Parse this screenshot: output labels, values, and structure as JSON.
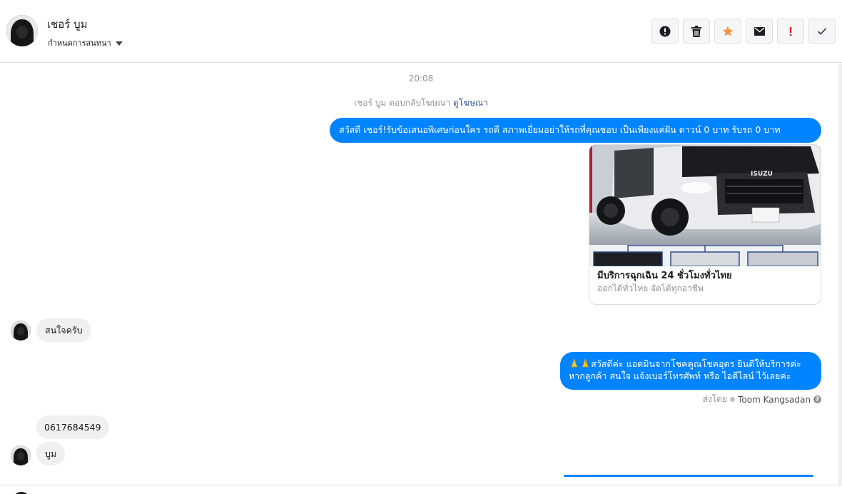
{
  "header": {
    "contact_name": "เชอร์ บูม",
    "assign_label": "กำหนดการสนทนา",
    "actions": [
      {
        "name": "report-spam",
        "icon": "alert-circle-icon"
      },
      {
        "name": "delete",
        "icon": "trash-icon"
      },
      {
        "name": "star",
        "icon": "star-icon"
      },
      {
        "name": "mark-unread",
        "icon": "envelope-icon"
      },
      {
        "name": "mark-important",
        "icon": "exclamation-icon"
      },
      {
        "name": "done",
        "icon": "check-icon"
      }
    ]
  },
  "conversation": {
    "timestamp": "20:08",
    "reply_note_prefix": "เชอร์ บูม ตอบกลับโฆษณา",
    "reply_note_link": "ดูโฆษณา",
    "messages": [
      {
        "direction": "outgoing",
        "text": "สวัสดี เชอร์!รับข้อเสนอพิเศษก่อนใคร รถดี สภาพเยี่ยมอย่าให้รถที่คุณชอบ เป็นเพียงแค่ฝัน ดาวน์ 0 บาท รับรถ 0 บาท"
      },
      {
        "direction": "incoming",
        "text": "สนใจครับ"
      },
      {
        "direction": "outgoing",
        "text": "🙏🙏สวัสดีค่ะ แอดมินจากโชคคูณโชคอุดร ยินดีให้บริการค่ะ หากลูกค้า สนใจ แจ้งเบอร์โทรศัพท์ หรือ ไอดีไลน์  ไว้เลยค่ะ"
      },
      {
        "direction": "incoming",
        "text": "0617684549"
      },
      {
        "direction": "incoming",
        "text": "บูม"
      }
    ],
    "ad_card": {
      "title": "มีบริการฉุกเฉิน 24 ชั่วโมงทั่วไทย",
      "subtitle": "ออกได้ทั่วไทย จัดได้ทุกอาชีพ",
      "image_brand": "ISUZU"
    },
    "sent_by_label": "ส่งโดย",
    "sent_by_agent": "Toom Kangsadan"
  },
  "colors": {
    "outgoing_bubble": "#0084ff",
    "incoming_bubble": "#f1f0f0",
    "star": "#f7923b",
    "important": "#e02020"
  }
}
